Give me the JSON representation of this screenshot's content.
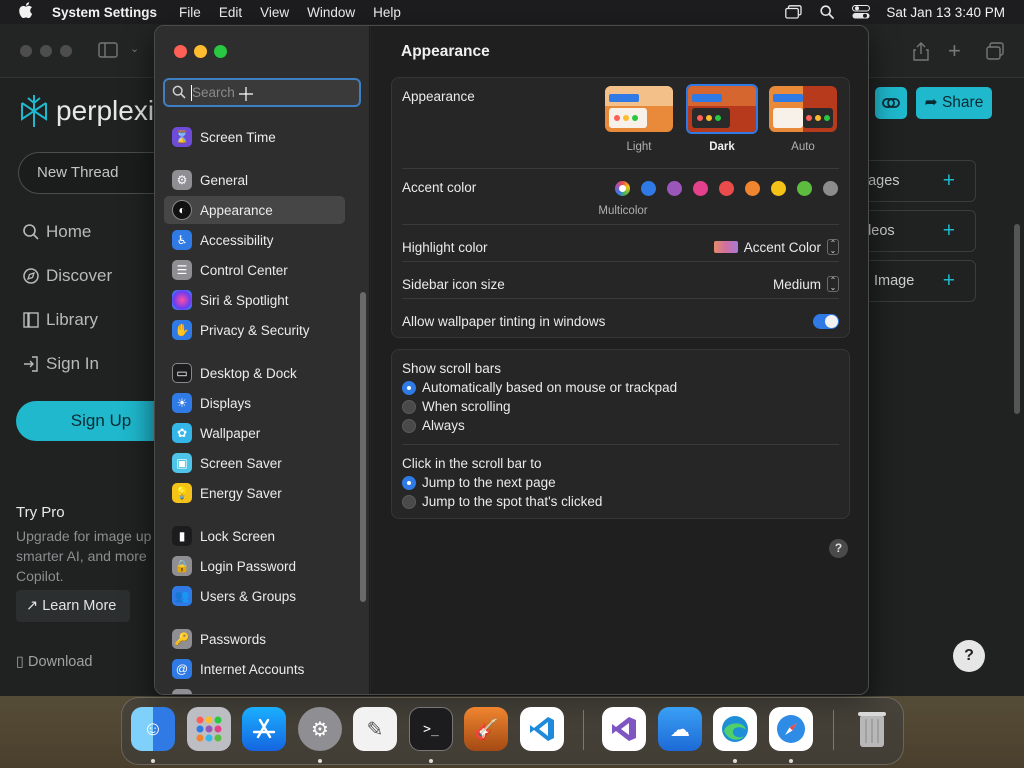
{
  "menubar": {
    "app_name": "System Settings",
    "menus": [
      "File",
      "Edit",
      "View",
      "Window",
      "Help"
    ],
    "clock": "Sat Jan 13  3:40 PM",
    "icons": [
      "window-icon",
      "search-icon",
      "control-center-icon"
    ]
  },
  "browser": {
    "logo_text": "perplexit",
    "new_thread": "New Thread",
    "nav": {
      "home": "Home",
      "discover": "Discover",
      "library": "Library",
      "sign_in": "Sign In"
    },
    "sign_up": "Sign Up",
    "try_pro_title": "Try Pro",
    "try_pro_desc": "Upgrade for image up smarter AI, and more Copilot.",
    "learn_more": "Learn More",
    "download": "Download",
    "share": "Share",
    "attachments": {
      "images": "nages",
      "videos": "ideos",
      "image": "Image"
    },
    "help": "?",
    "accent": "#1fb8cd"
  },
  "settings": {
    "search_placeholder": "Search",
    "sidebar": {
      "screen_time": "Screen Time",
      "general": "General",
      "appearance": "Appearance",
      "accessibility": "Accessibility",
      "control_center": "Control Center",
      "siri": "Siri & Spotlight",
      "privacy": "Privacy & Security",
      "desktop": "Desktop & Dock",
      "displays": "Displays",
      "wallpaper": "Wallpaper",
      "screen_saver": "Screen Saver",
      "energy": "Energy Saver",
      "lock_screen": "Lock Screen",
      "login_password": "Login Password",
      "users": "Users & Groups",
      "passwords": "Passwords",
      "internet_accounts": "Internet Accounts"
    },
    "selected_item": "Appearance",
    "title": "Appearance",
    "appearance_label": "Appearance",
    "themes": {
      "light": "Light",
      "dark": "Dark",
      "auto": "Auto"
    },
    "selected_theme": "Dark",
    "accent_label": "Accent color",
    "accent_selected_label": "Multicolor",
    "accent_colors": [
      "#2f7ae5",
      "#9b56b9",
      "#e5408c",
      "#ea4b4b",
      "#f0852f",
      "#f5c218",
      "#5dbb3f",
      "#8c8c8c"
    ],
    "highlight_label": "Highlight color",
    "highlight_value": "Accent Color",
    "sidebar_icon_label": "Sidebar icon size",
    "sidebar_icon_value": "Medium",
    "tinting_label": "Allow wallpaper tinting in windows",
    "tinting_on": true,
    "scroll_bars_label": "Show scroll bars",
    "scroll_options": {
      "auto": "Automatically based on mouse or trackpad",
      "scrolling": "When scrolling",
      "always": "Always"
    },
    "click_label": "Click in the scroll bar to",
    "click_options": {
      "next_page": "Jump to the next page",
      "spot": "Jump to the spot that's clicked"
    },
    "help": "?"
  },
  "dock": {
    "apps": [
      "Finder",
      "Launchpad",
      "App Store",
      "System Settings",
      "TextEdit",
      "Terminal",
      "GarageBand",
      "Visual Studio Code",
      "Visual Studio",
      "Weather",
      "Microsoft Edge",
      "Safari",
      "Trash"
    ]
  }
}
